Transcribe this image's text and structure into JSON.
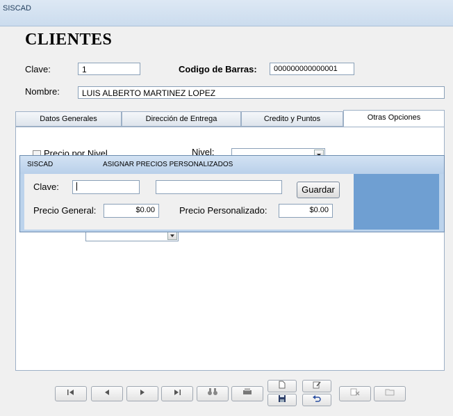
{
  "window": {
    "title": "SISCAD"
  },
  "form": {
    "title": "CLIENTES",
    "clave_label": "Clave:",
    "clave_value": "1",
    "barcode_label": "Codigo de Barras:",
    "barcode_value": "000000000000001",
    "nombre_label": "Nombre:",
    "nombre_value": "LUIS ALBERTO MARTINEZ LOPEZ"
  },
  "tabs": [
    {
      "label": "Datos Generales",
      "active": false
    },
    {
      "label": "Dirección de Entrega",
      "active": false
    },
    {
      "label": "Credito y Puntos",
      "active": false
    },
    {
      "label": "Otras Opciones",
      "active": true
    }
  ],
  "options": {
    "precio_nivel_label": "Precio por Nivel",
    "nivel_label": "Nivel:",
    "nivel_value": ""
  },
  "dialog": {
    "app": "SISCAD",
    "title": "ASIGNAR PRECIOS PERSONALIZADOS",
    "clave_label": "Clave:",
    "clave_value": "",
    "desc_value": "",
    "save_label": "Guardar",
    "precio_general_label": "Precio General:",
    "precio_general_value": "$0.00",
    "precio_personalizado_label": "Precio Personalizado:",
    "precio_personalizado_value": "$0.00"
  },
  "toolbar": {
    "first": "first-record-icon",
    "prev": "previous-record-icon",
    "next": "next-record-icon",
    "last": "last-record-icon",
    "search": "binoculars-icon",
    "print": "printer-icon",
    "new": "new-document-icon",
    "edit": "edit-icon",
    "save": "floppy-disk-icon",
    "undo": "undo-icon",
    "delete": "delete-icon",
    "extra": "folder-icon"
  }
}
